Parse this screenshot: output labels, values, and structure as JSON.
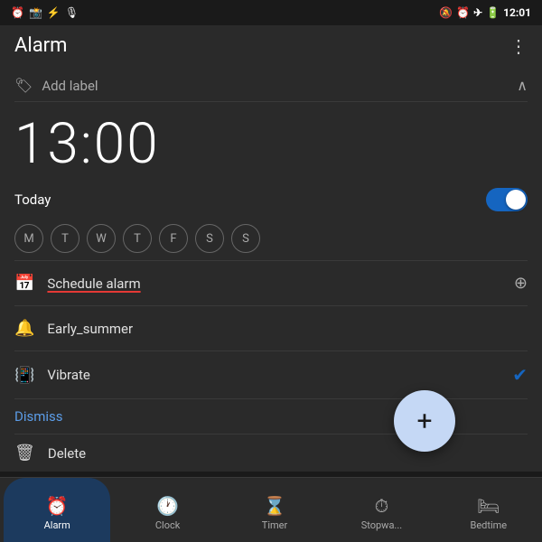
{
  "statusBar": {
    "time": "12:01",
    "leftIcons": [
      "⏰",
      "📷",
      "⚡",
      "🎙"
    ],
    "rightIcons": [
      "🔕",
      "⏰",
      "✈",
      "🔋"
    ]
  },
  "header": {
    "title": "Alarm",
    "menuIcon": "⋮"
  },
  "addLabel": {
    "icon": "🏷",
    "placeholder": "Add label",
    "chevron": "∧"
  },
  "time": {
    "display": "13:00"
  },
  "todayRow": {
    "label": "Today",
    "toggleOn": true
  },
  "days": [
    {
      "letter": "M",
      "active": false
    },
    {
      "letter": "T",
      "active": false
    },
    {
      "letter": "W",
      "active": false
    },
    {
      "letter": "T",
      "active": false
    },
    {
      "letter": "F",
      "active": false
    },
    {
      "letter": "S",
      "active": false
    },
    {
      "letter": "S",
      "active": false
    }
  ],
  "scheduleAlarm": {
    "label": "Schedule alarm",
    "addIcon": "⊕"
  },
  "ringtone": {
    "label": "Early_summer"
  },
  "vibrate": {
    "label": "Vibrate",
    "checked": true
  },
  "dismiss": {
    "label": "Dismiss",
    "fabIcon": "+"
  },
  "delete": {
    "label": "Delete"
  },
  "bottomNav": {
    "items": [
      {
        "icon": "⏰",
        "label": "Alarm",
        "active": true
      },
      {
        "icon": "🕐",
        "label": "Clock",
        "active": false
      },
      {
        "icon": "⌛",
        "label": "Timer",
        "active": false
      },
      {
        "icon": "⏱",
        "label": "Stopwa...",
        "active": false
      },
      {
        "icon": "🛏",
        "label": "Bedtime",
        "active": false
      }
    ]
  },
  "gestureBar": {
    "icons": [
      "<",
      "○",
      "≡"
    ]
  }
}
